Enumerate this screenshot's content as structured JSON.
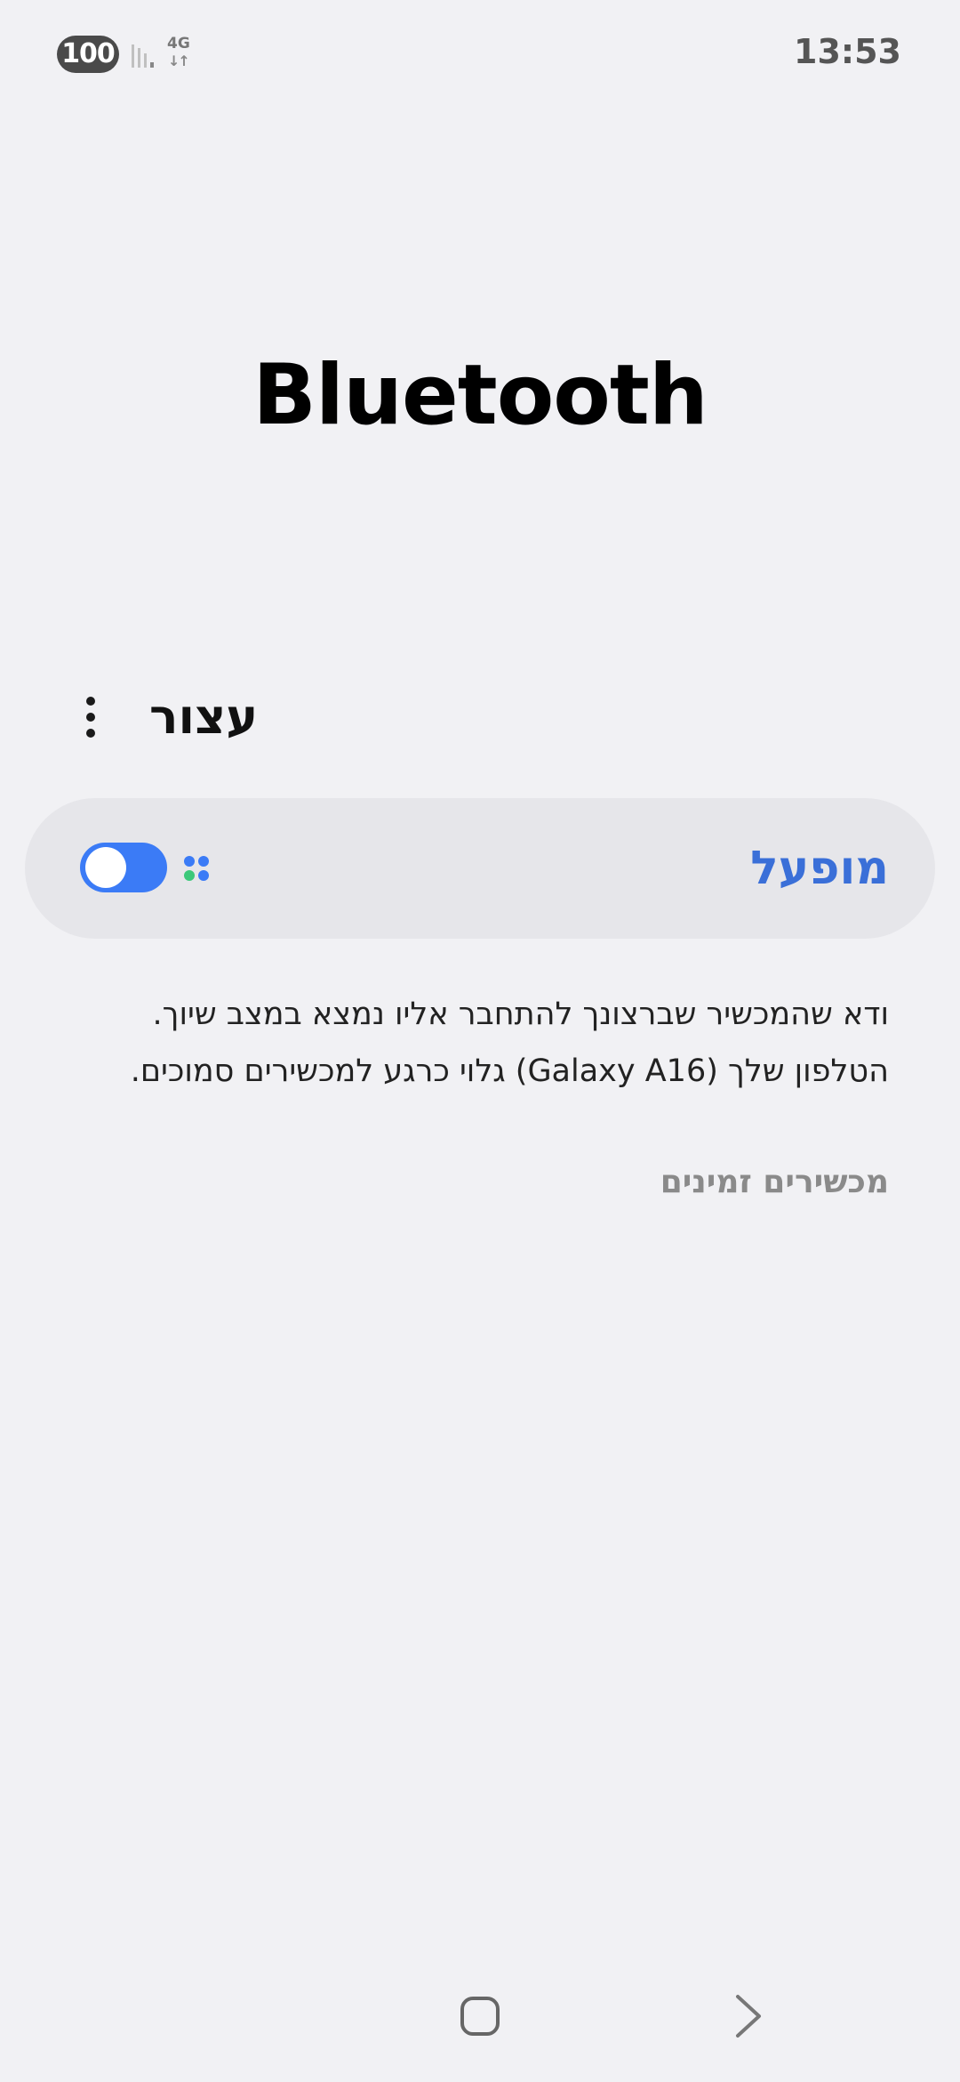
{
  "status_bar": {
    "battery": "100",
    "network_type": "4G",
    "network_arrows": "↓↑",
    "time": "13:53",
    "icons": [
      "signal-icon",
      "network-icon"
    ]
  },
  "page": {
    "title": "Bluetooth"
  },
  "toolbar": {
    "stop_label": "עצור",
    "more_icon": "more-vertical-icon"
  },
  "bluetooth_toggle": {
    "label": "מופעל",
    "state": "on",
    "accent_color": "#3b7bf6",
    "label_color": "#3a6fd8"
  },
  "description": {
    "line1": "ודא שהמכשיר שברצונך להתחבר אליו נמצא במצב שיוך.",
    "line2": "הטלפון שלך (Galaxy A16) גלוי כרגע למכשירים סמוכים."
  },
  "available_devices": {
    "header": "מכשירים זמינים",
    "items": []
  },
  "nav_bar": {
    "home_icon": "home-square-icon",
    "back_icon": "back-chevron-icon"
  }
}
